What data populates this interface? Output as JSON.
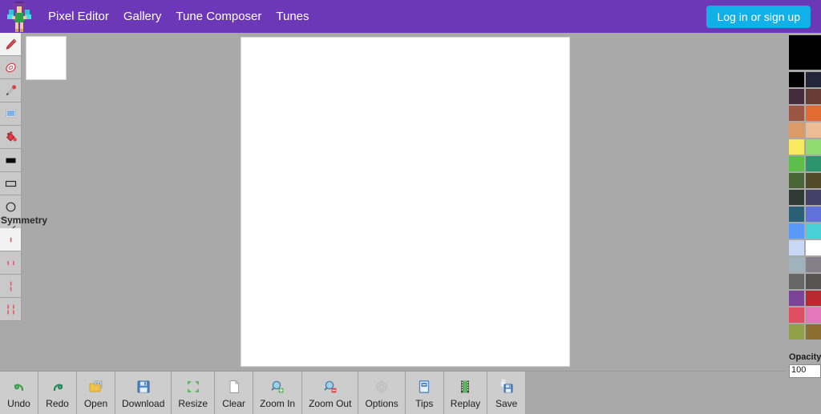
{
  "navbar": {
    "logo_icon": "fairy-pixel-logo",
    "links": [
      {
        "label": "Pixel Editor",
        "name": "nav-pixel-editor"
      },
      {
        "label": "Gallery",
        "name": "nav-gallery"
      },
      {
        "label": "Tune Composer",
        "name": "nav-tune-composer"
      },
      {
        "label": "Tunes",
        "name": "nav-tunes"
      }
    ],
    "login_label": "Log in or sign up",
    "bg_color": "#6c38b8",
    "login_color": "#12b0e8"
  },
  "tools": [
    {
      "name": "pencil-tool",
      "icon": "pencil-icon",
      "active": true
    },
    {
      "name": "eraser-tool",
      "icon": "eraser-icon",
      "active": false
    },
    {
      "name": "eyedropper-tool",
      "icon": "eyedropper-icon",
      "active": false
    },
    {
      "name": "select-tool",
      "icon": "select-icon",
      "active": false
    },
    {
      "name": "fill-tool",
      "icon": "paint-bucket-icon",
      "active": false
    },
    {
      "name": "filled-rect-tool",
      "icon": "filled-rect-icon",
      "active": false
    },
    {
      "name": "rect-tool",
      "icon": "rectangle-icon",
      "active": false
    },
    {
      "name": "ellipse-tool",
      "icon": "circle-icon",
      "active": false
    },
    {
      "name": "line-tool",
      "icon": "line-icon",
      "active": false
    }
  ],
  "symmetry": {
    "label": "Symmetry",
    "options": [
      {
        "name": "symmetry-none",
        "icon": "symmetry-none-icon",
        "active": true
      },
      {
        "name": "symmetry-vertical",
        "icon": "symmetry-vertical-icon",
        "active": false
      },
      {
        "name": "symmetry-horizontal",
        "icon": "symmetry-horizontal-icon",
        "active": false
      },
      {
        "name": "symmetry-both",
        "icon": "symmetry-both-icon",
        "active": false
      }
    ]
  },
  "bottom_toolbar": [
    {
      "label": "Undo",
      "name": "undo-button",
      "icon": "undo-arrow-icon"
    },
    {
      "label": "Redo",
      "name": "redo-button",
      "icon": "redo-arrow-icon"
    },
    {
      "label": "Open",
      "name": "open-button",
      "icon": "folder-open-icon"
    },
    {
      "label": "Download",
      "name": "download-button",
      "icon": "floppy-disk-icon"
    },
    {
      "label": "Resize",
      "name": "resize-button",
      "icon": "resize-arrows-icon"
    },
    {
      "label": "Clear",
      "name": "clear-button",
      "icon": "blank-page-icon"
    },
    {
      "label": "Zoom In",
      "name": "zoom-in-button",
      "icon": "magnifier-plus-icon"
    },
    {
      "label": "Zoom Out",
      "name": "zoom-out-button",
      "icon": "magnifier-minus-icon"
    },
    {
      "label": "Options",
      "name": "options-button",
      "icon": "gear-icon"
    },
    {
      "label": "Tips",
      "name": "tips-button",
      "icon": "book-icon"
    },
    {
      "label": "Replay",
      "name": "replay-button",
      "icon": "film-strip-icon"
    },
    {
      "label": "Save",
      "name": "save-button",
      "icon": "save-disk-icon"
    }
  ],
  "palette": {
    "current_color": "#000000",
    "swatches": [
      "#000000",
      "#23253a",
      "#452b3e",
      "#683b33",
      "#9a5642",
      "#e46c33",
      "#dc9a66",
      "#eebb97",
      "#f7ea5e",
      "#8fdd70",
      "#5dbe4c",
      "#2d9470",
      "#4a6535",
      "#524a29",
      "#2f3a35",
      "#434168",
      "#2a5f74",
      "#5f72dc",
      "#5b99f9",
      "#4ad1d8",
      "#c9d9f5",
      "#ffffff",
      "#a0b2bb",
      "#83808a",
      "#666666",
      "#555450",
      "#7c4496",
      "#b82a2f",
      "#df4f62",
      "#e278bb",
      "#91a149",
      "#8b6f30"
    ]
  },
  "opacity": {
    "label": "Opacity",
    "value": "100"
  },
  "canvas": {
    "background": "#ffffff"
  }
}
